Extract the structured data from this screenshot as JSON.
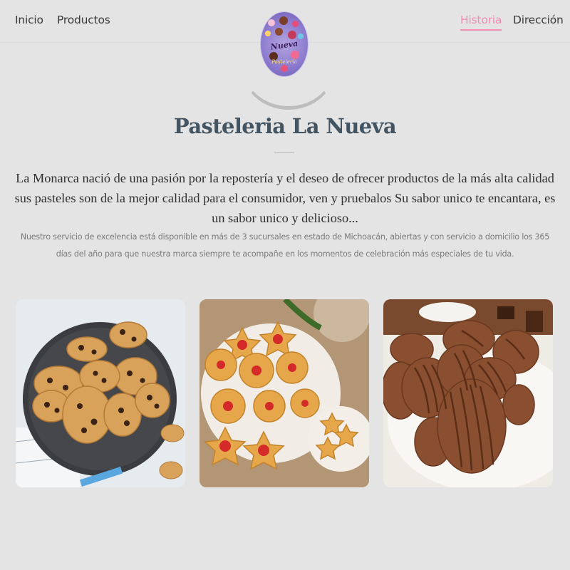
{
  "nav": {
    "left": [
      {
        "label": "Inicio"
      },
      {
        "label": "Productos"
      }
    ],
    "right": [
      {
        "label": "Historia",
        "active": true
      },
      {
        "label": "Dirección"
      }
    ],
    "active_color": "#f28db4"
  },
  "logo": {
    "text": "Nueva",
    "subtext": "Pastelería"
  },
  "page": {
    "title": "Pasteleria La Nueva",
    "intro": "La Monarca nació de una pasión por la repostería y el deseo de ofrecer productos de la más alta calidad sus pasteles son de la mejor calidad para el consumidor, ven y pruebalos Su sabor unico te encantara, es un sabor unico y delicioso...",
    "service": "Nuestro servicio de excelencia está disponible en más de 3 sucursales en estado de Michoacán, abiertas y con servicio a domicilio los 365 días del año para que nuestra marca siempre te acompañe en los momentos de celebración más especiales de tu vida."
  },
  "products": [
    {
      "image": "chocolate-chip-cookies"
    },
    {
      "image": "jam-star-cookies"
    },
    {
      "image": "chocolate-fork-cookies"
    }
  ],
  "colors": {
    "background": "#e4e4e4",
    "title": "#435563",
    "accent": "#f28db4"
  }
}
